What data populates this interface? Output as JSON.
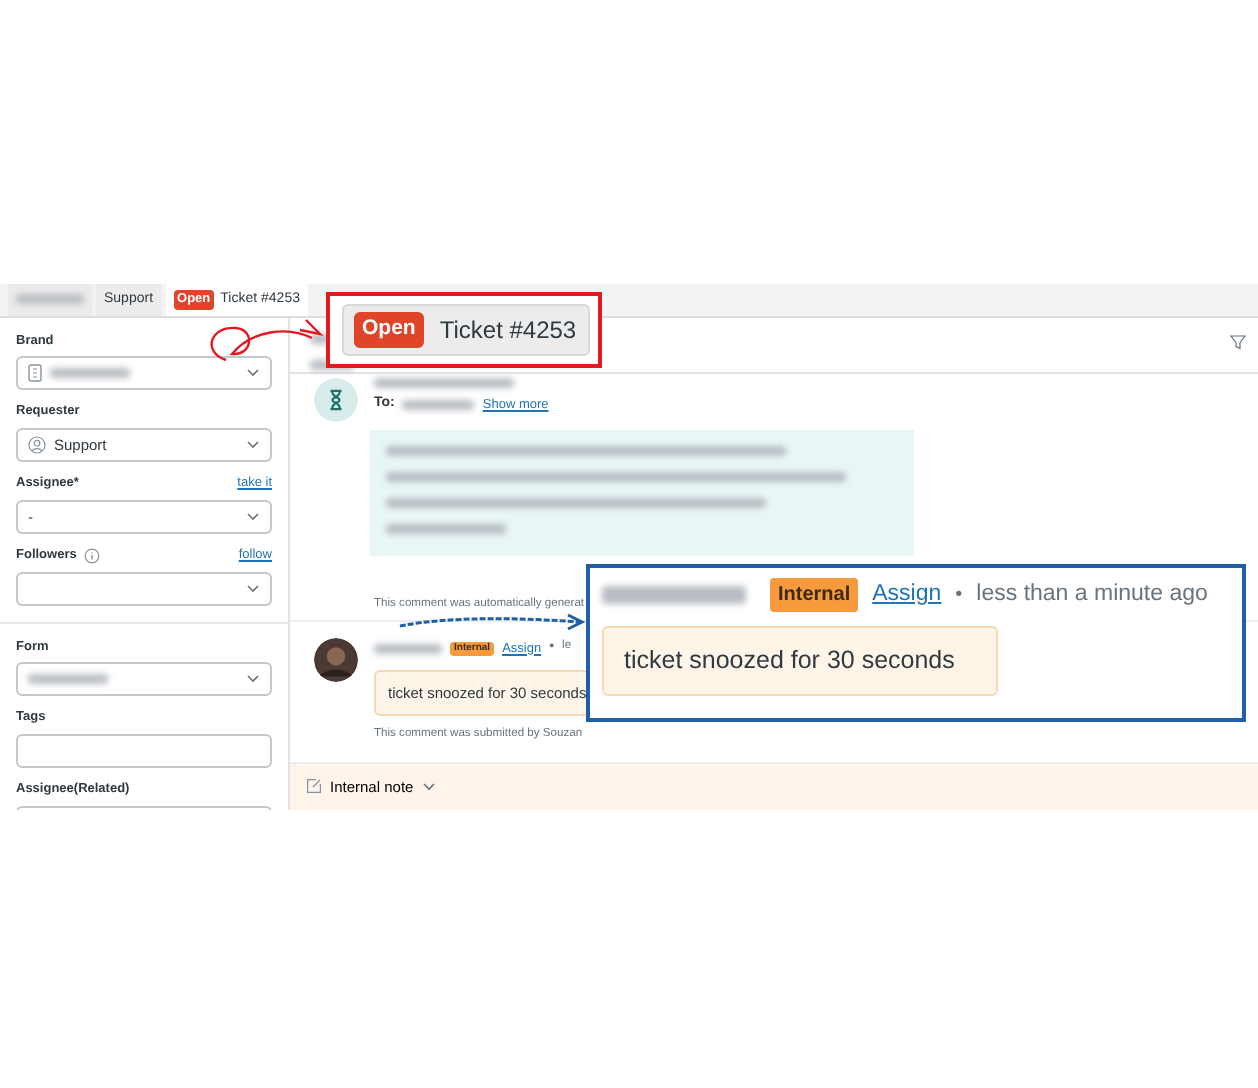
{
  "tabs": [
    {
      "kind": "redacted",
      "selected": false
    },
    {
      "kind": "plain",
      "label": "Support",
      "selected": false
    },
    {
      "kind": "ticket",
      "status": "Open",
      "label": "Ticket #4253",
      "selected": true
    }
  ],
  "sidebar": {
    "sections": [
      {
        "fields": [
          {
            "label": "Brand",
            "kind": "org_select",
            "redacted": true
          },
          {
            "label": "Requester",
            "kind": "person_select",
            "value": "Support"
          },
          {
            "label": "Assignee*",
            "kind": "select",
            "value": "-",
            "link": "take it"
          },
          {
            "label": "Followers",
            "kind": "select",
            "info": true,
            "link": "follow"
          }
        ]
      },
      {
        "fields": [
          {
            "label": "Form",
            "kind": "select",
            "redacted": true
          },
          {
            "label": "Tags",
            "kind": "input"
          },
          {
            "label": "Assignee(Related)",
            "kind": "input"
          }
        ]
      }
    ]
  },
  "conversation": {
    "header": {
      "redacted": true
    },
    "messages": [
      {
        "kind": "system",
        "to_label": "To:",
        "link": "Show more",
        "footer": "This comment was automatically generat"
      },
      {
        "kind": "internal",
        "badge": "Internal",
        "link": "Assign",
        "separator": "•",
        "time": "le",
        "body": "ticket snoozed for 30 seconds",
        "footer": "This comment was submitted by Souzan"
      }
    ],
    "composer": {
      "label": "Internal note"
    }
  },
  "callouts": [
    {
      "kind": "ticket",
      "color": "#e3191f",
      "status": "Open",
      "label": "Ticket #4253"
    },
    {
      "kind": "comment",
      "color": "#1f5fa8",
      "badge": "Internal",
      "link": "Assign",
      "separator": "•",
      "time": "less than a minute ago",
      "body": "ticket snoozed for 30 seconds"
    }
  ]
}
